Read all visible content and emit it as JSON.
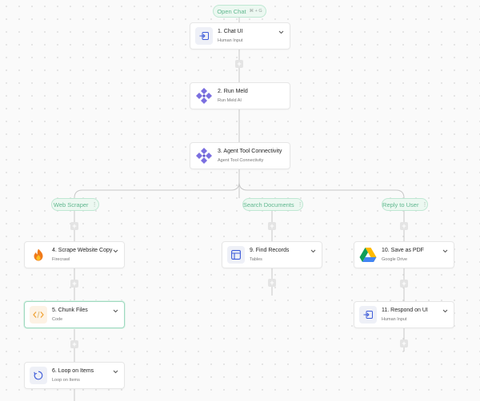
{
  "colors": {
    "accent": "#5fb78e",
    "wire": "#c8c8c8",
    "plus_bg": "#e4e4e4",
    "icon_blue": "#3d5bd9",
    "meld_purple": "#7b6fe0"
  },
  "top_pill": {
    "label": "Open Chat",
    "shortcut": "⌘ + G"
  },
  "branches": [
    {
      "label": "Web Scraper"
    },
    {
      "label": "Search Documents"
    },
    {
      "label": "Reply to User"
    }
  ],
  "nodes": [
    {
      "title": "1. Chat UI",
      "subtitle": "Human Input",
      "icon": "input-arrow-icon"
    },
    {
      "title": "2. Run Meld",
      "subtitle": "Run Meld AI",
      "icon": "meld-logo-icon"
    },
    {
      "title": "3. Agent Tool Connectivity",
      "subtitle": "Agent Tool Connectivity",
      "icon": "meld-logo-icon"
    },
    {
      "title": "4. Scrape Website Copy",
      "subtitle": "Firecrawl",
      "icon": "flame-icon"
    },
    {
      "title": "5. Chunk Files",
      "subtitle": "Code",
      "icon": "code-icon"
    },
    {
      "title": "6. Loop on Items",
      "subtitle": "Loop on Items",
      "icon": "loop-icon"
    },
    {
      "title": "9. Find Records",
      "subtitle": "Tables",
      "icon": "table-icon"
    },
    {
      "title": "10. Save as PDF",
      "subtitle": "Google Drive",
      "icon": "google-drive-icon"
    },
    {
      "title": "11. Respond on UI",
      "subtitle": "Human Input",
      "icon": "input-arrow-icon"
    }
  ],
  "add_step_label": "+"
}
